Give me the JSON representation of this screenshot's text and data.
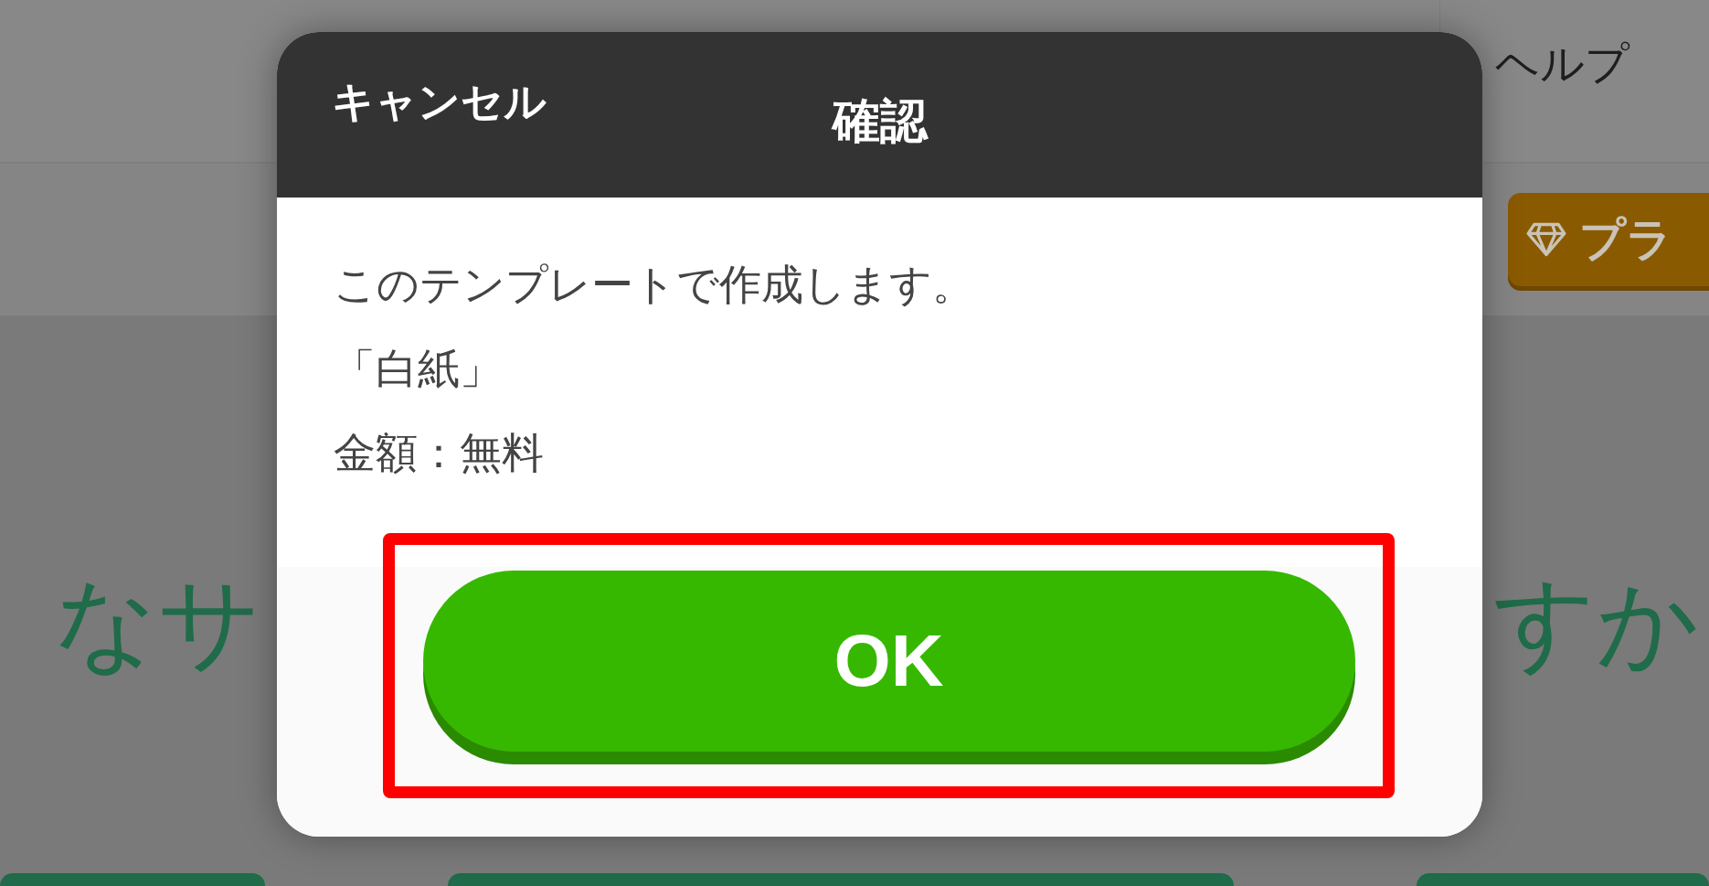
{
  "header": {
    "help_link": "ヘルプ",
    "plan_button": "プラ"
  },
  "background": {
    "heading_left": "なサ",
    "heading_right": "すか"
  },
  "dialog": {
    "cancel": "キャンセル",
    "title": "確認",
    "message": [
      "このテンプレートで作成します。",
      "「白紙」",
      "金額：無料"
    ],
    "ok": "OK"
  }
}
